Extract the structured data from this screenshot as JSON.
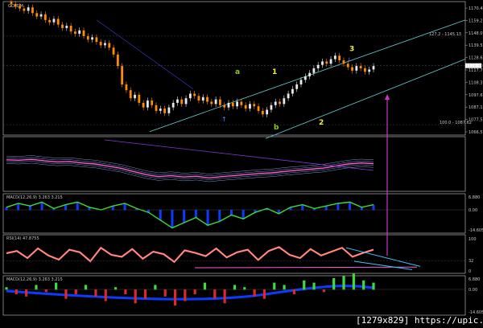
{
  "chart_data": [
    {
      "type": "candlestick",
      "title": "GOLDM",
      "x_points": 150,
      "y_ticks": [
        "1170.47",
        "1159.27",
        "1148.07",
        "1139.57",
        "1128.67",
        "1117.77",
        "1108.37",
        "1097.67",
        "1087.17",
        "1077.57",
        "1066.57"
      ],
      "price_readout": "1120.30",
      "fib_labels": [
        "127.2 - 1145.13",
        "100.0 - 1087.62"
      ],
      "closes": [
        1174,
        1172,
        1170,
        1168,
        1171,
        1166,
        1163,
        1165,
        1160,
        1158,
        1161,
        1156,
        1153,
        1155,
        1150,
        1148,
        1151,
        1146,
        1143,
        1145,
        1141,
        1138,
        1140,
        1136,
        1130,
        1120,
        1104,
        1099,
        1092,
        1095,
        1088,
        1084,
        1090,
        1086,
        1081,
        1083,
        1079,
        1084,
        1088,
        1091,
        1087,
        1092,
        1096,
        1094,
        1090,
        1093,
        1089,
        1087,
        1091,
        1086,
        1084,
        1088,
        1085,
        1089,
        1086,
        1083,
        1087,
        1085,
        1081,
        1078,
        1082,
        1086,
        1089,
        1087,
        1092,
        1096,
        1100,
        1104,
        1108,
        1111,
        1114,
        1118,
        1121,
        1124,
        1122,
        1126,
        1129,
        1125,
        1122,
        1119,
        1116,
        1120,
        1118,
        1115,
        1117,
        1120
      ],
      "wave_labels": [
        {
          "text": "a",
          "value": 1113
        },
        {
          "text": "1",
          "value": 1113
        },
        {
          "text": "b",
          "value": 1065
        },
        {
          "text": "2",
          "value": 1069
        },
        {
          "text": "3",
          "value": 1133
        }
      ],
      "colors": {
        "up": "#e8e8e8",
        "down": "#ff8c00",
        "channel": "#66cccc",
        "annotation": "#cc33cc"
      }
    },
    {
      "type": "line",
      "title": "",
      "series": [
        {
          "values": [
            0.2,
            0.18,
            0.22,
            0.15,
            0.1,
            0.12,
            0.05,
            0.0,
            -0.1,
            -0.2,
            -0.35,
            -0.5,
            -0.6,
            -0.55,
            -0.62,
            -0.58,
            -0.66,
            -0.6,
            -0.55,
            -0.5,
            -0.45,
            -0.42,
            -0.35,
            -0.3,
            -0.25,
            -0.2,
            -0.1,
            0.0,
            0.05,
            0.02
          ]
        }
      ],
      "colors": {
        "main": "#ff5ad8",
        "bands": "#7d9bd8",
        "trend": "#7d3bd8"
      }
    },
    {
      "type": "line",
      "title": "MACD(12,26,9) 3.263 3.215",
      "y_ticks": [
        "6.880",
        "0.00",
        "-14.605"
      ],
      "series": [
        {
          "values": [
            2,
            5,
            3,
            6,
            1,
            4,
            6,
            2,
            0,
            3,
            5,
            1,
            -2,
            -8,
            -14,
            -10,
            -6,
            -12,
            -9,
            -4,
            -7,
            -2,
            1,
            -3,
            2,
            4,
            1,
            3,
            5,
            6,
            2,
            4
          ]
        }
      ],
      "colors": {
        "line": "#3cdc3c",
        "hist": "#0a3cff"
      }
    },
    {
      "type": "line",
      "title": "RSI(14) 47.8755",
      "y_ticks": [
        "100",
        "32",
        "0"
      ],
      "series": [
        {
          "values": [
            55,
            62,
            40,
            70,
            48,
            35,
            66,
            58,
            30,
            72,
            50,
            44,
            68,
            38,
            60,
            52,
            28,
            64,
            56,
            46,
            70,
            42,
            58,
            66,
            34,
            62,
            74,
            50,
            40,
            68,
            48,
            60,
            72,
            44,
            56,
            66
          ]
        }
      ],
      "colors": {
        "line": "#ff9f3c",
        "accent": "#ff5ad8",
        "trend": "#3cc8ff"
      }
    },
    {
      "type": "bar",
      "title": "MACD(12,26,9) 3.263 3.215",
      "y_ticks": [
        "6.880",
        "0.00",
        "-14.605"
      ],
      "values": [
        1,
        -2,
        -3,
        2,
        -1,
        3,
        -4,
        -2,
        2,
        -3,
        -5,
        1,
        -2,
        -6,
        -4,
        2,
        -3,
        -7,
        -5,
        -2,
        3,
        -4,
        -6,
        2,
        1,
        -3,
        -4,
        3,
        2,
        -2,
        4,
        3,
        -1,
        5,
        6,
        7,
        4,
        3
      ],
      "colors": {
        "pos": "#3cdc3c",
        "neg": "#dc2828",
        "signal": "#0a3cff"
      }
    }
  ],
  "watermark": "[1279x829] https://upic.me/"
}
